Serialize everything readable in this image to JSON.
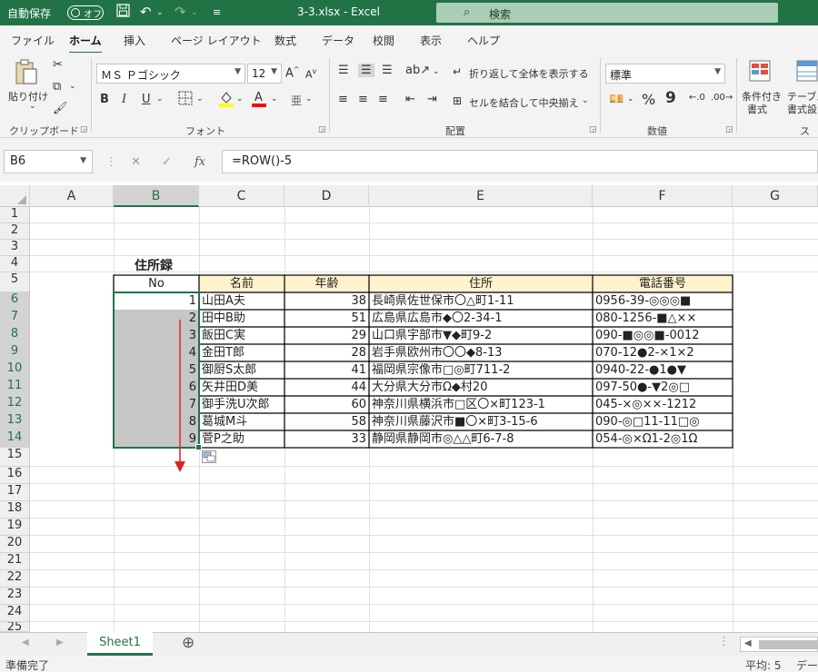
{
  "titlebar": {
    "autosave_label": "自動保存",
    "autosave_state": "オフ",
    "filename": "3-3.xlsx - Excel",
    "search_placeholder": "検索"
  },
  "tabs": [
    "ファイル",
    "ホーム",
    "挿入",
    "ページ レイアウト",
    "数式",
    "データ",
    "校閲",
    "表示",
    "ヘルプ"
  ],
  "active_tab": "ホーム",
  "ribbon": {
    "clipboard": {
      "paste": "貼り付け",
      "group": "クリップボード"
    },
    "font": {
      "name": "ＭＳ Ｐゴシック",
      "size": "12",
      "bold": "B",
      "italic": "I",
      "underline": "U",
      "group": "フォント"
    },
    "alignment": {
      "wrap": "折り返して全体を表示する",
      "merge": "セルを結合して中央揃え",
      "group": "配置"
    },
    "number": {
      "format": "標準",
      "percent": "%",
      "comma": "9",
      "group": "数値"
    },
    "styles": {
      "conditional": "条件付き",
      "conditional2": "書式",
      "table": "テーブル",
      "table2": "書式設",
      "group": "スタ"
    }
  },
  "formula_bar": {
    "name_box": "B6",
    "formula": "=ROW()-5",
    "cancel": "✕",
    "enter": "✓",
    "fx": "fx"
  },
  "columns": [
    "A",
    "B",
    "C",
    "D",
    "E",
    "F",
    "G"
  ],
  "selected_column": "B",
  "rows": [
    "1",
    "2",
    "3",
    "4",
    "5",
    "6",
    "7",
    "8",
    "9",
    "10",
    "11",
    "12",
    "13",
    "14",
    "15",
    "16",
    "17",
    "18",
    "19",
    "20",
    "21",
    "22",
    "23",
    "24",
    "25"
  ],
  "sheet": {
    "title": "住所録",
    "headers": [
      "No",
      "名前",
      "年齢",
      "住所",
      "電話番号"
    ],
    "records": [
      {
        "no": "1",
        "name": "山田A夫",
        "age": "38",
        "address": "長崎県佐世保市〇△町1-11",
        "phone": "0956-39-◎◎◎■"
      },
      {
        "no": "2",
        "name": "田中B助",
        "age": "51",
        "address": "広島県広島市◆〇2-34-1",
        "phone": "080-1256-■△××"
      },
      {
        "no": "3",
        "name": "飯田C実",
        "age": "29",
        "address": "山口県宇部市▼◆町9-2",
        "phone": "090-■◎◎■-0012"
      },
      {
        "no": "4",
        "name": "金田T郎",
        "age": "28",
        "address": "岩手県欧州市〇〇◆8-13",
        "phone": "070-12●2-×1×2"
      },
      {
        "no": "5",
        "name": "御厨S太郎",
        "age": "41",
        "address": "福岡県宗像市□◎町711-2",
        "phone": "0940-22-●1●▼"
      },
      {
        "no": "6",
        "name": "矢井田D美",
        "age": "44",
        "address": "大分県大分市Ω◆村20",
        "phone": "097-50●-▼2◎□"
      },
      {
        "no": "7",
        "name": "御手洗U次郎",
        "age": "60",
        "address": "神奈川県横浜市□区〇×町123-1",
        "phone": "045-×◎××-1212"
      },
      {
        "no": "8",
        "name": "葛城M斗",
        "age": "58",
        "address": "神奈川県藤沢市■〇×町3-15-6",
        "phone": "090-◎□11-11□◎"
      },
      {
        "no": "9",
        "name": "菅P之助",
        "age": "33",
        "address": "静岡県静岡市◎△△町6-7-8",
        "phone": "054-◎×Ω1-2◎1Ω"
      }
    ]
  },
  "sheet_tabs": [
    "Sheet1"
  ],
  "status": {
    "ready": "準備完了",
    "average": "平均: 5",
    "extra": "デー"
  },
  "colors": {
    "accent": "#217346",
    "header_fill": "#fff2cc",
    "selection_fill": "#c6c6c6",
    "arrow": "#e02020"
  }
}
